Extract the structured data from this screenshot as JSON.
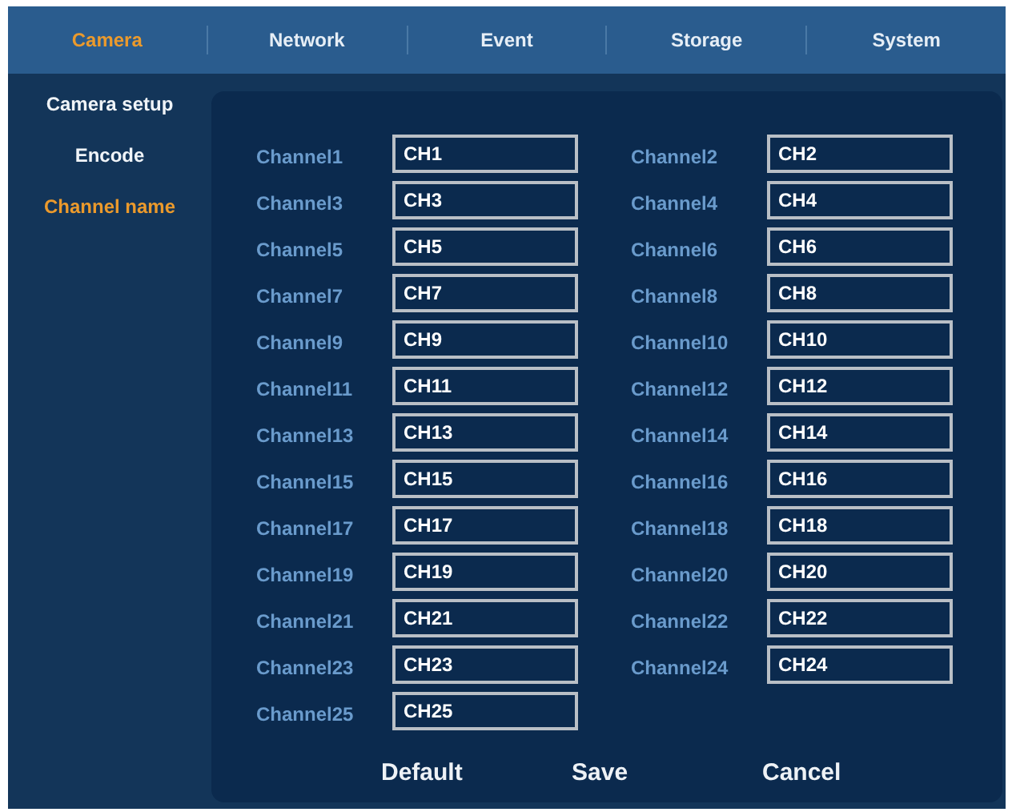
{
  "tabs": [
    {
      "label": "Camera",
      "selected": true
    },
    {
      "label": "Network",
      "selected": false
    },
    {
      "label": "Event",
      "selected": false
    },
    {
      "label": "Storage",
      "selected": false
    },
    {
      "label": "System",
      "selected": false
    }
  ],
  "sidebar": {
    "items": [
      {
        "label": "Camera setup",
        "selected": false
      },
      {
        "label": "Encode",
        "selected": false
      },
      {
        "label": "Channel name",
        "selected": true
      }
    ]
  },
  "channels": [
    {
      "label": "Channel1",
      "value": "CH1"
    },
    {
      "label": "Channel2",
      "value": "CH2"
    },
    {
      "label": "Channel3",
      "value": "CH3"
    },
    {
      "label": "Channel4",
      "value": "CH4"
    },
    {
      "label": "Channel5",
      "value": "CH5"
    },
    {
      "label": "Channel6",
      "value": "CH6"
    },
    {
      "label": "Channel7",
      "value": "CH7"
    },
    {
      "label": "Channel8",
      "value": "CH8"
    },
    {
      "label": "Channel9",
      "value": "CH9"
    },
    {
      "label": "Channel10",
      "value": "CH10"
    },
    {
      "label": "Channel11",
      "value": "CH11"
    },
    {
      "label": "Channel12",
      "value": "CH12"
    },
    {
      "label": "Channel13",
      "value": "CH13"
    },
    {
      "label": "Channel14",
      "value": "CH14"
    },
    {
      "label": "Channel15",
      "value": "CH15"
    },
    {
      "label": "Channel16",
      "value": "CH16"
    },
    {
      "label": "Channel17",
      "value": "CH17"
    },
    {
      "label": "Channel18",
      "value": "CH18"
    },
    {
      "label": "Channel19",
      "value": "CH19"
    },
    {
      "label": "Channel20",
      "value": "CH20"
    },
    {
      "label": "Channel21",
      "value": "CH21"
    },
    {
      "label": "Channel22",
      "value": "CH22"
    },
    {
      "label": "Channel23",
      "value": "CH23"
    },
    {
      "label": "Channel24",
      "value": "CH24"
    },
    {
      "label": "Channel25",
      "value": "CH25"
    }
  ],
  "buttons": [
    "Default",
    "Save",
    "Cancel"
  ]
}
